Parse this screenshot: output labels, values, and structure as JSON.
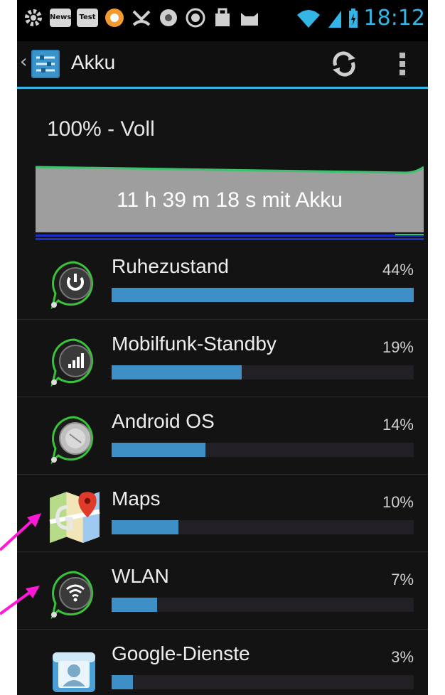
{
  "status_bar": {
    "icons": [
      "gear-icon",
      "news-icon",
      "test-icon",
      "orange-app-icon",
      "missed-call-icon",
      "gallery-icon",
      "sync-icon",
      "bag-icon",
      "cat-icon"
    ],
    "news_label": "News",
    "test_label": "Test",
    "time": "18:12",
    "accent_color": "#33b5e5"
  },
  "action_bar": {
    "title": "Akku",
    "back_glyph": "‹"
  },
  "battery": {
    "level": "100% - Voll",
    "history_label": "11 h 39 m 18 s mit Akku"
  },
  "usage": [
    {
      "name": "Ruhezustand",
      "percent": "44%",
      "fraction": 1.0,
      "icon": "power-icon"
    },
    {
      "name": "Mobilfunk-Standby",
      "percent": "19%",
      "fraction": 0.43,
      "icon": "signal-icon"
    },
    {
      "name": "Android OS",
      "percent": "14%",
      "fraction": 0.31,
      "icon": "android-os-icon"
    },
    {
      "name": "Maps",
      "percent": "10%",
      "fraction": 0.22,
      "icon": "maps-icon"
    },
    {
      "name": "WLAN",
      "percent": "7%",
      "fraction": 0.15,
      "icon": "wifi-icon"
    },
    {
      "name": "Google-Dienste",
      "percent": "3%",
      "fraction": 0.07,
      "icon": "contacts-icon"
    }
  ]
}
